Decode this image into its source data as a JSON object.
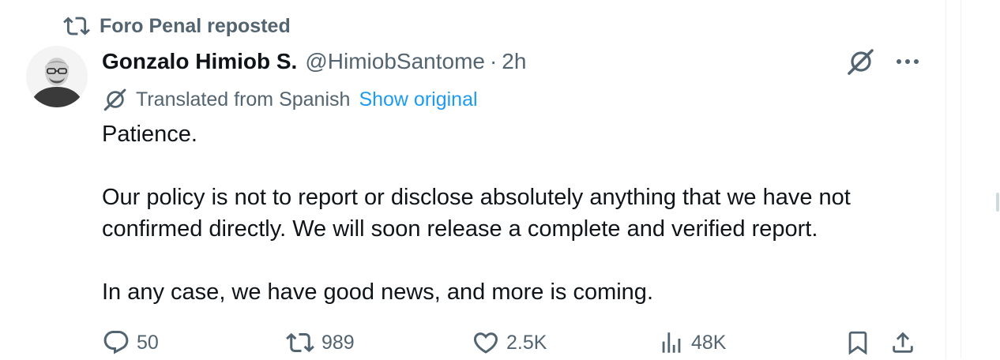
{
  "repost": {
    "text": "Foro Penal reposted",
    "icon": "repost-icon"
  },
  "author": {
    "name": "Gonzalo Himiob S.",
    "handle": "@HimiobSantome",
    "separator": "·",
    "time": "2h",
    "avatar": "avatar"
  },
  "translation": {
    "label": "Translated from Spanish",
    "show_original": "Show original",
    "icon": "translate-icon"
  },
  "post": {
    "paragraphs": [
      "Patience.",
      "Our policy is not to report or disclose absolutely anything that we have not confirmed directly. We will soon release a complete and verified report.",
      "In any case, we have good news, and more is coming."
    ]
  },
  "stats": {
    "replies": "50",
    "reposts": "989",
    "likes": "2.5K",
    "views": "48K"
  },
  "colors": {
    "text": "#0f1419",
    "muted": "#536471",
    "link": "#1d9bf0"
  }
}
